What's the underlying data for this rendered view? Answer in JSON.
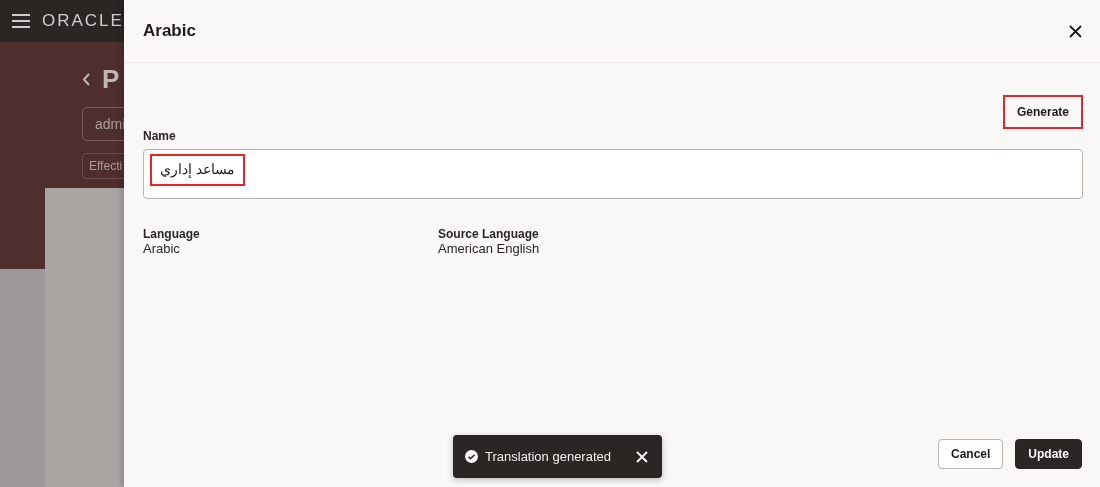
{
  "background_page": {
    "logo": "ORACLE",
    "title": "P",
    "fields": [
      {
        "kind": "input",
        "value": "admi"
      },
      {
        "kind": "chip",
        "value": "Effecti"
      }
    ]
  },
  "drawer": {
    "title": "Arabic",
    "generate_button": {
      "label": "Generate",
      "highlighted": true
    },
    "name_field": {
      "label": "Name",
      "value": "مساعد إداري",
      "highlighted": true
    },
    "details": [
      {
        "label": "Language",
        "value": "Arabic"
      },
      {
        "label": "Source Language",
        "value": "American English"
      }
    ],
    "buttons": [
      {
        "label": "Cancel",
        "kind": "secondary"
      },
      {
        "label": "Update",
        "kind": "primary"
      }
    ]
  },
  "toast": {
    "message": "Translation generated"
  }
}
